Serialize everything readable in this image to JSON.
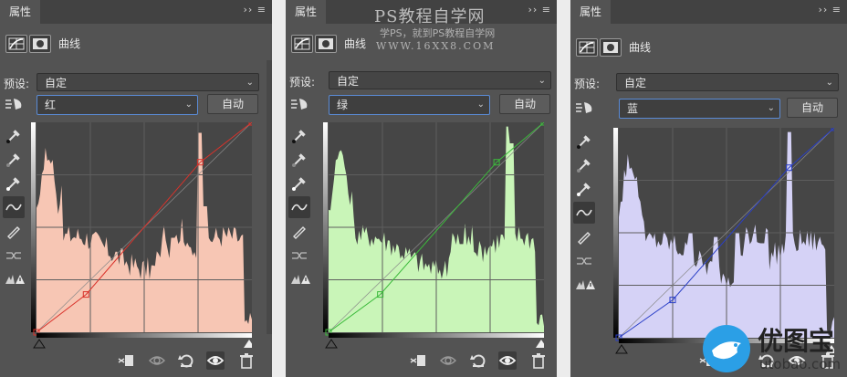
{
  "panels": [
    {
      "tab_label": "属性",
      "tab_controls": "›› ≡",
      "header_title": "曲线",
      "preset_label": "预设:",
      "preset_value": "自定",
      "channel_value": "红",
      "auto_label": "自动",
      "curve_color": "#d9322b",
      "histogram_fill": "#f7c6b4",
      "curve_points": [
        [
          0,
          0
        ],
        [
          0.23,
          0.18
        ],
        [
          0.76,
          0.81
        ],
        [
          1,
          1
        ]
      ],
      "active_tool": "curve-tool"
    },
    {
      "tab_label": "属性",
      "tab_controls": "›› ≡",
      "header_title": "曲线",
      "preset_label": "预设:",
      "preset_value": "自定",
      "channel_value": "绿",
      "auto_label": "自动",
      "curve_color": "#3cba3c",
      "histogram_fill": "#c9f5b8",
      "curve_points": [
        [
          0,
          0
        ],
        [
          0.24,
          0.18
        ],
        [
          0.78,
          0.81
        ],
        [
          1,
          1
        ]
      ],
      "active_tool": "curve-tool"
    },
    {
      "tab_label": "属性",
      "tab_controls": "›› ≡",
      "header_title": "曲线",
      "preset_label": "预设:",
      "preset_value": "自定",
      "channel_value": "蓝",
      "auto_label": "自动",
      "curve_color": "#2a3fc7",
      "histogram_fill": "#d5d2f6",
      "curve_points": [
        [
          0,
          0
        ],
        [
          0.25,
          0.18
        ],
        [
          0.79,
          0.81
        ],
        [
          1,
          1
        ]
      ],
      "active_tool": "curve-tool"
    }
  ],
  "watermark": {
    "title": "PS教程自学网",
    "subtitle": "学PS，就到PS教程自学网",
    "url": "WWW.16XX8.COM"
  },
  "logo": {
    "text": "优图宝",
    "url": "utobao.com"
  },
  "icons": {
    "tools": [
      "eyedropper-black-icon",
      "eyedropper-gray-icon",
      "eyedropper-white-icon",
      "curve-tool-icon",
      "pencil-icon",
      "smooth-icon",
      "clipping-warning-icon"
    ],
    "bottom": [
      "clip-to-layer-icon",
      "view-previous-icon",
      "reset-icon",
      "visibility-eye-icon",
      "trash-icon"
    ]
  }
}
